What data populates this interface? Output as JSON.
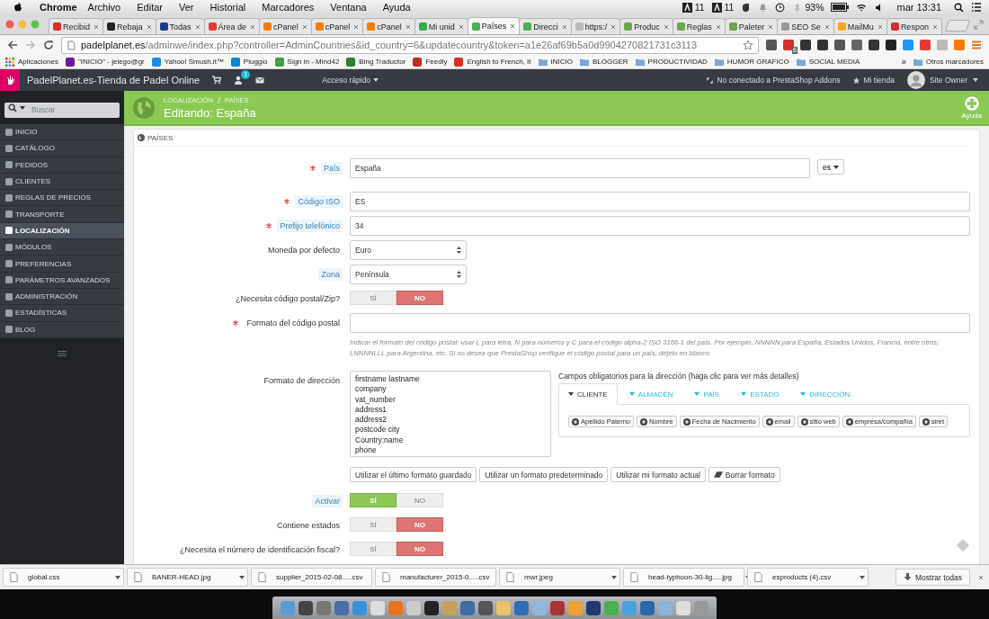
{
  "menubar": {
    "app": "Chrome",
    "menus": [
      "Archivo",
      "Editar",
      "Ver",
      "Historial",
      "Marcadores",
      "Ventana",
      "Ayuda"
    ],
    "adobe_counts": [
      "11",
      "11"
    ],
    "battery": "93%",
    "clock": "mar 13:31"
  },
  "browser": {
    "tabs": [
      {
        "title": "Recibid",
        "selected": false
      },
      {
        "title": "Rebaja",
        "selected": false
      },
      {
        "title": "Todas",
        "selected": false
      },
      {
        "title": "Área de",
        "selected": false
      },
      {
        "title": "cPanel",
        "selected": false
      },
      {
        "title": "cPanel",
        "selected": false
      },
      {
        "title": "cPanel",
        "selected": false
      },
      {
        "title": "Mi unid",
        "selected": false
      },
      {
        "title": "Países",
        "selected": true
      },
      {
        "title": "Direcci",
        "selected": false
      },
      {
        "title": "https:/",
        "selected": false
      },
      {
        "title": "Produc",
        "selected": false
      },
      {
        "title": "Reglas",
        "selected": false
      },
      {
        "title": "Paleter",
        "selected": false
      },
      {
        "title": "SEO Se",
        "selected": false
      },
      {
        "title": "MailMu",
        "selected": false
      },
      {
        "title": "Respon",
        "selected": false
      }
    ],
    "url": {
      "host": "padelplanet.es",
      "path": "/adminwe/index.php?controller=AdminCountries&id_country=6&updatecountry&token=a1e26af69b5a0d9904270821731c3113"
    },
    "extension_badge": "6",
    "bookmarks": [
      {
        "label": "Aplicaciones",
        "kind": "apps"
      },
      {
        "label": "\"INICIO\" - jelego@gr",
        "kind": "site"
      },
      {
        "label": "Yahoo! Smush.it™",
        "kind": "site"
      },
      {
        "label": "Pluggio",
        "kind": "site"
      },
      {
        "label": "Sign in - Mind42",
        "kind": "site"
      },
      {
        "label": "Bing Traductor",
        "kind": "site"
      },
      {
        "label": "Feedly",
        "kind": "site"
      },
      {
        "label": "English to French, It",
        "kind": "site"
      },
      {
        "label": "INICIO",
        "kind": "folder"
      },
      {
        "label": "BLOGGER",
        "kind": "folder"
      },
      {
        "label": "PRODUCTIVIDAD",
        "kind": "folder"
      },
      {
        "label": "HUMOR GRAFICO",
        "kind": "folder"
      },
      {
        "label": "SOCIAL MEDIA",
        "kind": "folder"
      }
    ],
    "bookmarks_overflow": "»",
    "other_bookmarks": "Otros marcadores"
  },
  "admin": {
    "shop_name": "PadelPlanet.es-Tienda de Padel Online",
    "notifications": "1",
    "quick_access": "Acceso rápido",
    "addons": "No conectado a PrestaShop Addons",
    "my_shop": "Mi tienda",
    "user": "Site Owner"
  },
  "sidebar": {
    "search_placeholder": "Buscar",
    "items": [
      {
        "label": "INICIO",
        "selected": false
      },
      {
        "label": "CATÁLOGO",
        "selected": false
      },
      {
        "label": "PEDIDOS",
        "selected": false
      },
      {
        "label": "CLIENTES",
        "selected": false
      },
      {
        "label": "REGLAS DE PRECIOS",
        "selected": false
      },
      {
        "label": "TRANSPORTE",
        "selected": false
      },
      {
        "label": "LOCALIZACIÓN",
        "selected": true
      },
      {
        "label": "MÓDULOS",
        "selected": false
      },
      {
        "label": "PREFERENCIAS",
        "selected": false
      },
      {
        "label": "PARÁMETROS AVANZADOS",
        "selected": false
      },
      {
        "label": "ADMINISTRACIÓN",
        "selected": false
      },
      {
        "label": "ESTADÍSTICAS",
        "selected": false
      },
      {
        "label": "BLOG",
        "selected": false
      }
    ]
  },
  "page": {
    "breadcrumb": [
      "LOCALIZACIÓN",
      "PAÍSES"
    ],
    "title": "Editando: España",
    "help": "Ayuda"
  },
  "panel": {
    "heading": "PAÍSES",
    "fields": [
      {
        "kind": "text",
        "label": "País",
        "required": true,
        "hint": true,
        "value": "España",
        "language": "es"
      },
      {
        "kind": "text",
        "label": "Código ISO",
        "required": true,
        "hint": true,
        "value": "ES"
      },
      {
        "kind": "text",
        "label": "Prefijo telefónico",
        "required": true,
        "hint": true,
        "value": "34"
      },
      {
        "kind": "select",
        "label": "Moneda por defecto",
        "required": false,
        "hint": false,
        "value": "Euro"
      },
      {
        "kind": "select",
        "label": "Zona",
        "required": false,
        "hint": true,
        "value": "Península"
      },
      {
        "kind": "toggle",
        "label": "¿Necesita código postal/Zip?",
        "required": false,
        "hint": false,
        "on": false,
        "yes": "SÍ",
        "no": "NO"
      },
      {
        "kind": "text",
        "label": "Formato del código postal",
        "required": true,
        "hint": false,
        "help": "Indicar el formato del código postal: usar L para letra, N para números y C para el código alpha-2 ISO 3166-1 del país. Por ejemplo, NNNNN para España, Estados Unidos, Francia, entre otros; LNNNNLLL para Argentina, etc. Si no desea que PrestaShop verifique el código postal para un país, déjelo en blanco."
      },
      {
        "kind": "address",
        "label": "Formato de dirección",
        "required": false,
        "hint": false,
        "lines": [
          "firstname lastname",
          "company",
          "vat_number",
          "address1",
          "address2",
          "postcode city",
          "Country:name",
          "phone"
        ],
        "fields_title": "Campos obligatorios para la dirección (haga clic para ver más detalles)",
        "tabs": [
          {
            "label": "CLIENTE",
            "selected": true
          },
          {
            "label": "ALMACÉN",
            "selected": false
          },
          {
            "label": "PAÍS",
            "selected": false
          },
          {
            "label": "ESTADO",
            "selected": false
          },
          {
            "label": "DIRECCIÓN",
            "selected": false
          }
        ],
        "chips": [
          "Apellido Paterno",
          "Nombre",
          "Fecha de Nacimiento",
          "email",
          "sitio web",
          "empresa/compañía",
          "siret"
        ],
        "buttons": [
          {
            "label": "Utilizar el último formato guardado",
            "kind": "plain"
          },
          {
            "label": "Utilizar un formato predeterminado",
            "kind": "plain"
          },
          {
            "label": "Utilizar mi formato actual",
            "kind": "plain"
          },
          {
            "label": "Borrar formato",
            "kind": "eraser"
          }
        ]
      },
      {
        "kind": "toggle",
        "label": "Activar",
        "required": false,
        "hint": true,
        "on": true,
        "yes": "SÍ",
        "no": "NO"
      },
      {
        "kind": "toggle",
        "label": "Contiene estados",
        "required": false,
        "hint": false,
        "on": false,
        "yes": "SÍ",
        "no": "NO"
      },
      {
        "kind": "toggle",
        "label": "¿Necesita el número de identificación fiscal?",
        "required": false,
        "hint": false,
        "on": false,
        "yes": "SÍ",
        "no": "NO"
      }
    ]
  },
  "downloads": {
    "files": [
      "global.css",
      "BANER-HEAD.jpg",
      "supplier_2015-02-08.....csv",
      "manufacturer_2015-0.....csv",
      "mwr.jpeg",
      "head-typhoon-30-lig.....jpg",
      "esproducts (4).csv"
    ],
    "show_all": "Mostrar todas"
  }
}
